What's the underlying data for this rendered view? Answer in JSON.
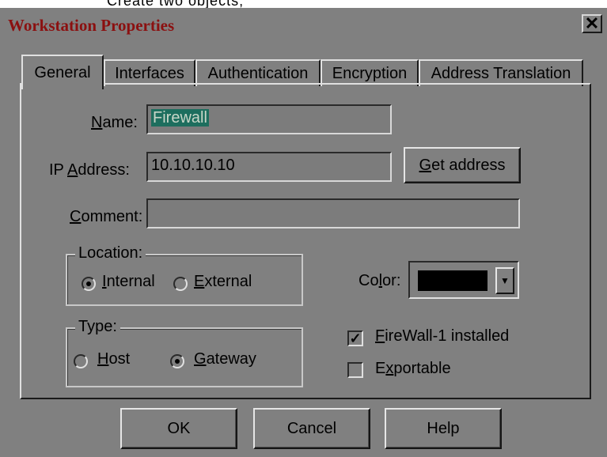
{
  "background_caption": "Create two objects;",
  "window": {
    "title": "Workstation Properties",
    "close_glyph": "✕"
  },
  "tabs": [
    {
      "label": "General"
    },
    {
      "label": "Interfaces"
    },
    {
      "label": "Authentication"
    },
    {
      "label": "Encryption"
    },
    {
      "label": "Address Translation"
    }
  ],
  "general": {
    "name_label_pre": "",
    "name_label_ul": "N",
    "name_label_post": "ame:",
    "name_value": "Firewall",
    "ip_label_pre": "IP ",
    "ip_label_ul": "A",
    "ip_label_post": "ddress:",
    "ip_value": "10.10.10.10",
    "get_address_ul": "G",
    "get_address_post": "et address",
    "comment_label_ul": "C",
    "comment_label_post": "omment:",
    "comment_value": "",
    "location_title": "Location:",
    "internal_ul": "I",
    "internal_post": "nternal",
    "external_ul": "E",
    "external_post": "xternal",
    "location_selected": "internal",
    "color_label_pre": "Co",
    "color_label_ul": "l",
    "color_label_post": "or:",
    "color_value": "#000000",
    "type_title": "Type:",
    "host_ul": "H",
    "host_post": "ost",
    "gateway_ul": "G",
    "gateway_post": "ateway",
    "type_selected": "gateway",
    "firewall_ul": "F",
    "firewall_post": "ireWall-1 installed",
    "firewall_checked": true,
    "exportable_pre": "E",
    "exportable_ul": "x",
    "exportable_post": "portable",
    "exportable_checked": false
  },
  "buttons": {
    "ok": "OK",
    "cancel": "Cancel",
    "help": "Help"
  },
  "icons": {
    "close": "close-icon",
    "dropdown": "chevron-down-icon"
  },
  "colors": {
    "title": "#8b1010",
    "selection": "#1d6e5e"
  }
}
